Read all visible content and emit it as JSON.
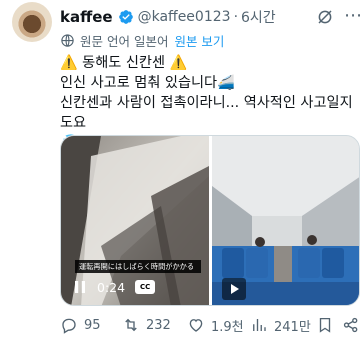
{
  "tweet": {
    "display_name": "kaffee",
    "handle": "@kaffee0123",
    "separator": "·",
    "time": "6시간",
    "translation_notice": "원문 언어 일본어",
    "show_original": "원본 보기",
    "text": "⚠️ 동해도 신칸센 ⚠️\n인신 사고로 멈춰 있습니다🚄\n신칸센과 사람이 접촉이라니... 역사적인 사고일지도요\n💦"
  },
  "video": {
    "caption": "運転再開にはしばらく時間がかかる",
    "time": "0:24",
    "cc_label": "CC"
  },
  "actions": {
    "replies": "95",
    "retweets": "232",
    "likes": "1.9천",
    "views": "241만"
  },
  "colors": {
    "verified": "#1d9bf0",
    "link": "#1d9bf0",
    "muted": "#536471",
    "text": "#0f1419"
  },
  "icons": [
    "verified-badge-icon",
    "grok-icon",
    "more-icon",
    "translate-icon",
    "pause-icon",
    "cc-icon",
    "play-icon",
    "reply-icon",
    "retweet-icon",
    "like-icon",
    "views-icon",
    "bookmark-icon",
    "share-icon"
  ]
}
